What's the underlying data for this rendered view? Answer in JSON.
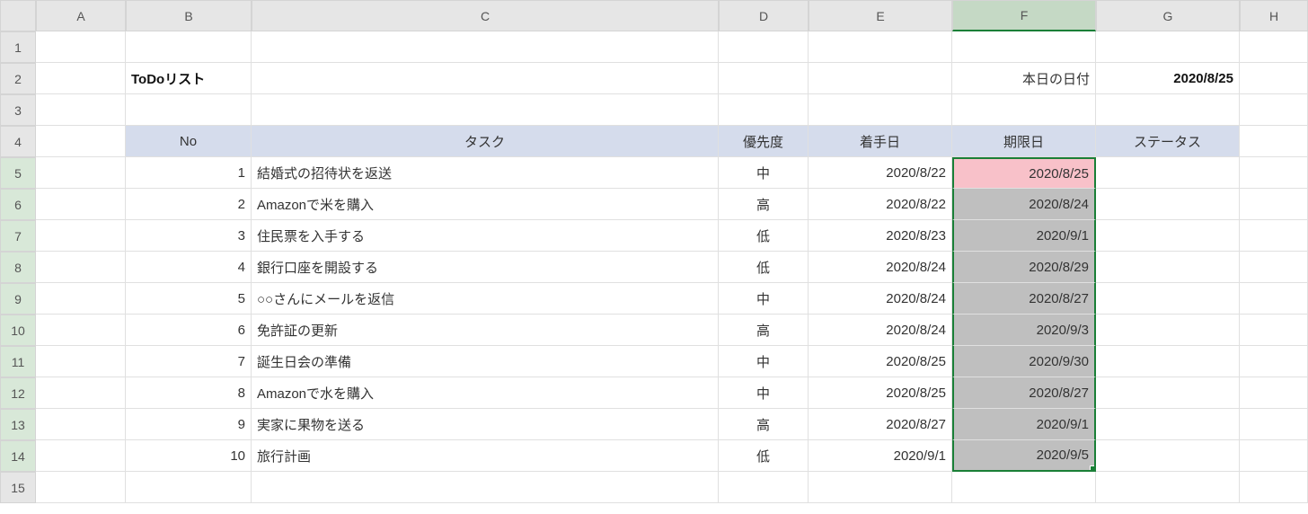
{
  "columns": [
    "A",
    "B",
    "C",
    "D",
    "E",
    "F",
    "G",
    "H"
  ],
  "rowNumbers": [
    "1",
    "2",
    "3",
    "4",
    "5",
    "6",
    "7",
    "8",
    "9",
    "10",
    "11",
    "12",
    "13",
    "14",
    "15"
  ],
  "title": "ToDoリスト",
  "todayLabel": "本日の日付",
  "todayValue": "2020/8/25",
  "headers": {
    "no": "No",
    "task": "タスク",
    "priority": "優先度",
    "start": "着手日",
    "due": "期限日",
    "status": "ステータス"
  },
  "rows": [
    {
      "no": "1",
      "task": "結婚式の招待状を返送",
      "priority": "中",
      "start": "2020/8/22",
      "due": "2020/8/25",
      "pink": true
    },
    {
      "no": "2",
      "task": "Amazonで米を購入",
      "priority": "高",
      "start": "2020/8/22",
      "due": "2020/8/24"
    },
    {
      "no": "3",
      "task": "住民票を入手する",
      "priority": "低",
      "start": "2020/8/23",
      "due": "2020/9/1"
    },
    {
      "no": "4",
      "task": "銀行口座を開設する",
      "priority": "低",
      "start": "2020/8/24",
      "due": "2020/8/29"
    },
    {
      "no": "5",
      "task": "○○さんにメールを返信",
      "priority": "中",
      "start": "2020/8/24",
      "due": "2020/8/27"
    },
    {
      "no": "6",
      "task": "免許証の更新",
      "priority": "高",
      "start": "2020/8/24",
      "due": "2020/9/3"
    },
    {
      "no": "7",
      "task": "誕生日会の準備",
      "priority": "中",
      "start": "2020/8/25",
      "due": "2020/9/30"
    },
    {
      "no": "8",
      "task": "Amazonで水を購入",
      "priority": "中",
      "start": "2020/8/25",
      "due": "2020/8/27"
    },
    {
      "no": "9",
      "task": "実家に果物を送る",
      "priority": "高",
      "start": "2020/8/27",
      "due": "2020/9/1"
    },
    {
      "no": "10",
      "task": "旅行計画",
      "priority": "低",
      "start": "2020/9/1",
      "due": "2020/9/5"
    }
  ]
}
